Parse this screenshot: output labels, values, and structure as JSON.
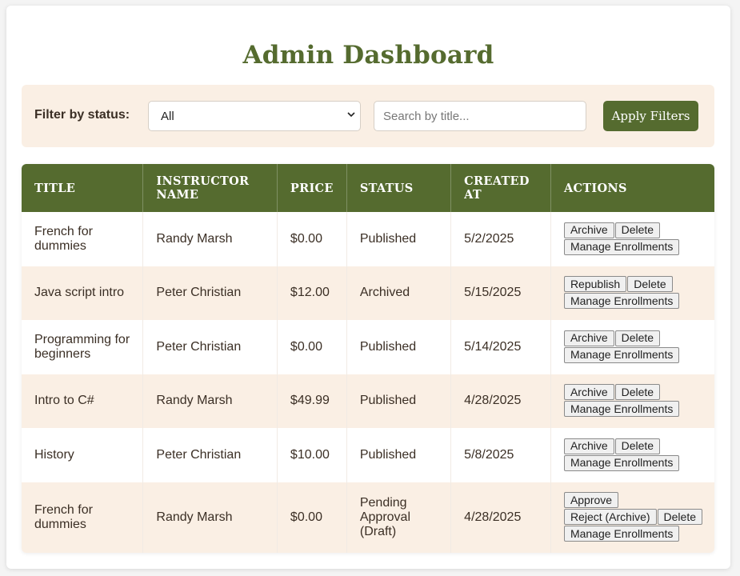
{
  "page": {
    "title": "Admin Dashboard"
  },
  "filters": {
    "label": "Filter by status:",
    "status_selected": "All",
    "search_placeholder": "Search by title...",
    "search_value": "",
    "apply_label": "Apply Filters"
  },
  "table": {
    "headers": [
      "Title",
      "Instructor Name",
      "Price",
      "Status",
      "Created At",
      "Actions"
    ],
    "rows": [
      {
        "title": "French for dummies",
        "instructor": "Randy Marsh",
        "price": "$0.00",
        "status": "Published",
        "created": "5/2/2025",
        "actions": [
          [
            "Archive",
            "Delete"
          ],
          [
            "Manage Enrollments"
          ]
        ]
      },
      {
        "title": "Java script intro",
        "instructor": "Peter Christian",
        "price": "$12.00",
        "status": "Archived",
        "created": "5/15/2025",
        "actions": [
          [
            "Republish",
            "Delete"
          ],
          [
            "Manage Enrollments"
          ]
        ]
      },
      {
        "title": "Programming for beginners",
        "instructor": "Peter Christian",
        "price": "$0.00",
        "status": "Published",
        "created": "5/14/2025",
        "actions": [
          [
            "Archive",
            "Delete"
          ],
          [
            "Manage Enrollments"
          ]
        ]
      },
      {
        "title": "Intro to C#",
        "instructor": "Randy Marsh",
        "price": "$49.99",
        "status": "Published",
        "created": "4/28/2025",
        "actions": [
          [
            "Archive",
            "Delete"
          ],
          [
            "Manage Enrollments"
          ]
        ]
      },
      {
        "title": "History",
        "instructor": "Peter Christian",
        "price": "$10.00",
        "status": "Published",
        "created": "5/8/2025",
        "actions": [
          [
            "Archive",
            "Delete"
          ],
          [
            "Manage Enrollments"
          ]
        ]
      },
      {
        "title": "French for dummies",
        "instructor": "Randy Marsh",
        "price": "$0.00",
        "status": "Pending Approval (Draft)",
        "created": "4/28/2025",
        "actions": [
          [
            "Approve"
          ],
          [
            "Reject (Archive)",
            "Delete"
          ],
          [
            "Manage Enrollments"
          ]
        ]
      }
    ]
  },
  "colors": {
    "accent": "#556b2f",
    "row_alt": "#faefe4",
    "text": "#3b2f25"
  },
  "icons": {
    "select_chevron": "chevron-down-icon"
  }
}
